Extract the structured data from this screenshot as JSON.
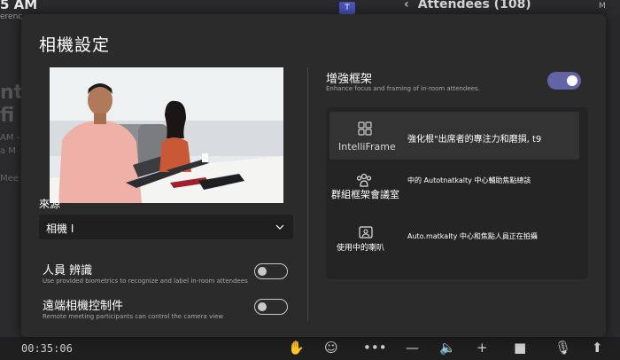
{
  "background": {
    "time": "5 AM",
    "sub": "erenc",
    "title_line1": "nto",
    "title_line2": "fi",
    "line3": "AM -",
    "line4": "a M",
    "line5": "Mee",
    "teams_icon_letter": "T",
    "attendees": "Attendees (108)",
    "right_small": "M"
  },
  "bottom_bar": {
    "time": "00:35:06",
    "icons": [
      "raise-hand-icon",
      "emoji-icon",
      "more-icon",
      "minus-icon",
      "speaker-icon",
      "add-icon",
      "camera-icon",
      "mic-icon",
      "share-icon"
    ]
  },
  "modal": {
    "title": "相機設定",
    "source": {
      "label": "來源",
      "value": "相機 I"
    },
    "people_recognition": {
      "title": "人員 辨識",
      "description": "Use provided biometrics to recognize and label in-room attendees",
      "enabled": false
    },
    "far_end_control": {
      "title": "遠端相機控制件",
      "description": "Remote meeting participants can control the camera view",
      "enabled": false
    },
    "enhanced_frame": {
      "title": "增強框架",
      "description": "Enhance focus and framing of in-room attendees.",
      "enabled": true
    },
    "modes": [
      {
        "icon": "grid-icon",
        "name": "IntelliFrame",
        "description": "強化根\"出席者的專注力和磨損, t9",
        "selected": true
      },
      {
        "icon": "group-icon",
        "name": "群組框架會議室",
        "description": "中的 Autotnatkalty 中心輔助焦點總該",
        "selected": false
      },
      {
        "icon": "speaker-person-icon",
        "name": "使用中的喇叭",
        "description": "Auto.matkalty 中心和焦點人員正在拍攝",
        "selected": false
      }
    ]
  },
  "colors": {
    "accent": "#6264a7",
    "modal_bg": "#2b2b2b",
    "panel_bg": "#242424",
    "selected_card": "#333333"
  }
}
